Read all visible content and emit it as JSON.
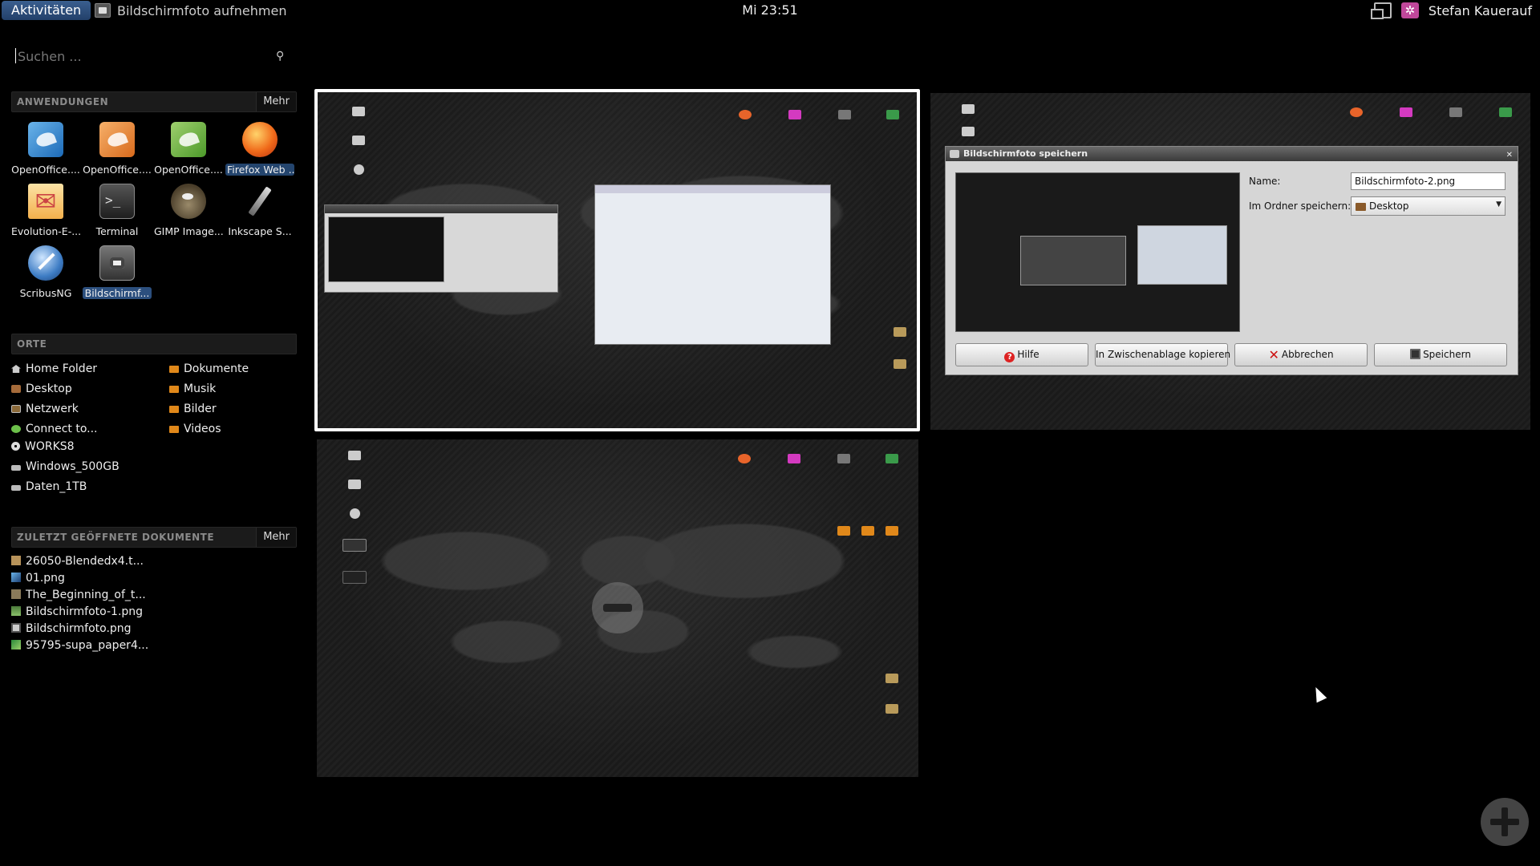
{
  "top_panel": {
    "activities_label": "Aktivitäten",
    "app_menu_label": "Bildschirmfoto aufnehmen",
    "clock": "Mi 23:51",
    "user_name": "Stefan Kauerauf"
  },
  "search": {
    "placeholder": "Suchen ..."
  },
  "applications": {
    "title": "ANWENDUNGEN",
    "more_label": "Mehr",
    "items": [
      {
        "label": "OpenOffice...."
      },
      {
        "label": "OpenOffice...."
      },
      {
        "label": "OpenOffice...."
      },
      {
        "label": "Firefox Web ..."
      },
      {
        "label": "Evolution-E-..."
      },
      {
        "label": "Terminal"
      },
      {
        "label": "GIMP Image..."
      },
      {
        "label": "Inkscape S..."
      },
      {
        "label": "ScribusNG"
      },
      {
        "label": "Bildschirmf..."
      }
    ]
  },
  "places": {
    "title": "ORTE",
    "left": [
      {
        "label": "Home Folder"
      },
      {
        "label": "Desktop"
      },
      {
        "label": "Netzwerk"
      },
      {
        "label": "Connect to..."
      },
      {
        "label": "WORKS8"
      },
      {
        "label": "Windows_500GB"
      },
      {
        "label": "Daten_1TB"
      }
    ],
    "right": [
      {
        "label": "Dokumente"
      },
      {
        "label": "Musik"
      },
      {
        "label": "Bilder"
      },
      {
        "label": "Videos"
      }
    ]
  },
  "recent": {
    "title": "ZULETZT GEÖFFNETE DOKUMENTE",
    "more_label": "Mehr",
    "items": [
      {
        "label": "26050-Blendedx4.t..."
      },
      {
        "label": "01.png"
      },
      {
        "label": "The_Beginning_of_t..."
      },
      {
        "label": "Bildschirmfoto-1.png"
      },
      {
        "label": "Bildschirmfoto.png"
      },
      {
        "label": "95795-supa_paper4..."
      }
    ]
  },
  "save_dialog": {
    "title": "Bildschirmfoto speichern",
    "name_label": "Name:",
    "name_value": "Bildschirmfoto-2.png",
    "folder_label": "Im Ordner speichern:",
    "folder_value": "Desktop",
    "help_label": "Hilfe",
    "copy_label": "In Zwischenablage kopieren",
    "cancel_label": "Abbrechen",
    "save_label": "Speichern"
  }
}
